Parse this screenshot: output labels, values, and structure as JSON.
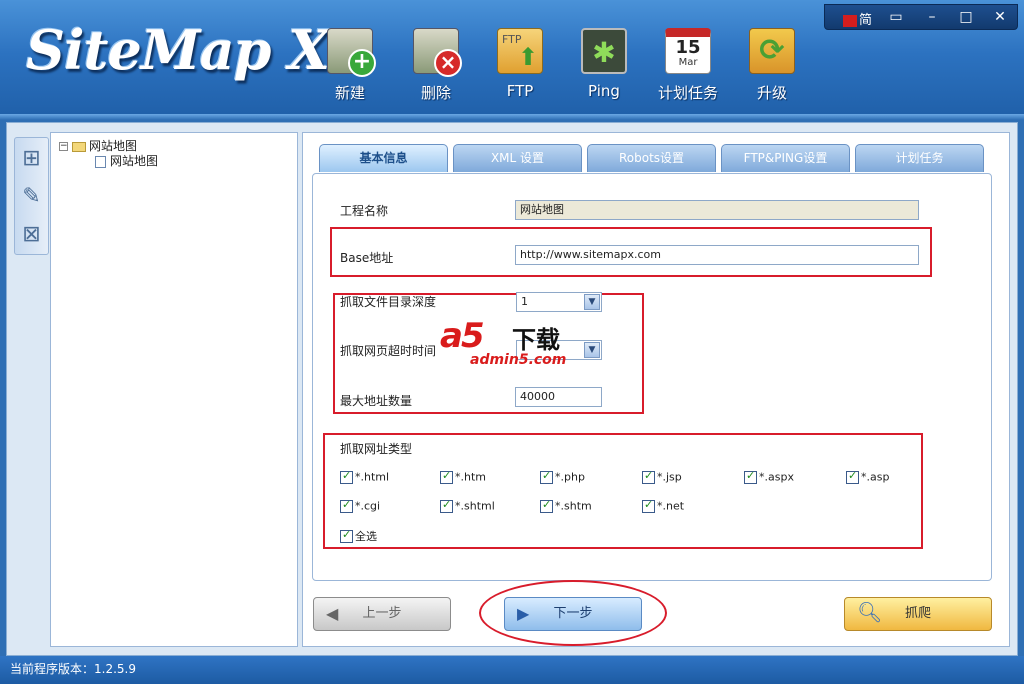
{
  "app": {
    "logo_text": "SiteMap X",
    "version_label": "当前程序版本：1.2.5.9"
  },
  "window_controls": {
    "language": "简",
    "minimize_glyph": "▭",
    "restore_glyph": "–",
    "maximize_glyph": "□",
    "close_glyph": "✕"
  },
  "toolbar": {
    "new": "新建",
    "delete": "删除",
    "ftp": "FTP",
    "ftp_icon_text": "FTP",
    "ping": "Ping",
    "schedule": "计划任务",
    "calendar_day": "15",
    "calendar_month": "Mar",
    "upgrade": "升级"
  },
  "tree": {
    "root": "网站地图",
    "child": "网站地图",
    "expander": "−"
  },
  "tabs": [
    {
      "label": "基本信息",
      "active": true
    },
    {
      "label": "XML 设置",
      "active": false
    },
    {
      "label": "Robots设置",
      "active": false
    },
    {
      "label": "FTP&PING设置",
      "active": false
    },
    {
      "label": "计划任务",
      "active": false
    }
  ],
  "form": {
    "project_name_label": "工程名称",
    "project_name_value": "网站地图",
    "base_url_label": "Base地址",
    "base_url_value": "http://www.sitemapx.com",
    "depth_label": "抓取文件目录深度",
    "depth_value": "1",
    "timeout_label": "抓取网页超时时间",
    "timeout_value": "",
    "max_urls_label": "最大地址数量",
    "max_urls_value": "40000",
    "types_label": "抓取网址类型",
    "select_all": "全选"
  },
  "file_types": [
    "*.html",
    "*.htm",
    "*.php",
    "*.jsp",
    "*.aspx",
    "*.asp",
    "*.cgi",
    "*.shtml",
    "*.shtm",
    "*.net"
  ],
  "watermark": {
    "brand": "a5",
    "text": "下载",
    "site": "admin5.com"
  },
  "buttons": {
    "prev": "上一步",
    "next": "下一步",
    "crawl": "抓爬"
  },
  "colors": {
    "header_blue": "#2c72c0",
    "highlight_red": "#d81c2b",
    "crawl_yellow": "#f0b840"
  }
}
